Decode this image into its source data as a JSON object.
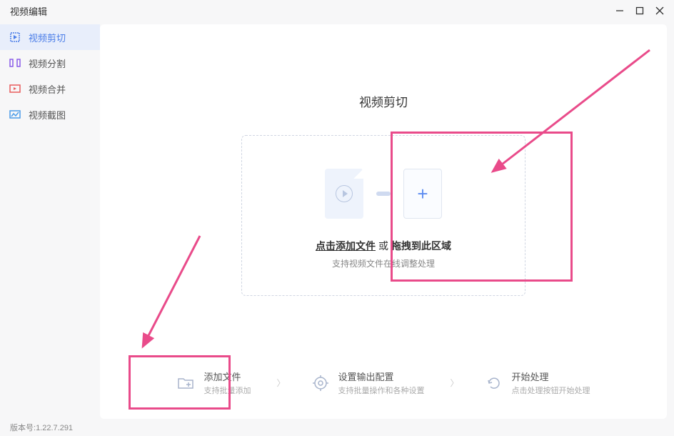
{
  "titlebar": {
    "title": "视频编辑"
  },
  "sidebar": {
    "items": [
      {
        "label": "视频剪切",
        "icon": "crop-icon",
        "active": true
      },
      {
        "label": "视频分割",
        "icon": "split-icon",
        "active": false
      },
      {
        "label": "视频合并",
        "icon": "merge-icon",
        "active": false
      },
      {
        "label": "视频截图",
        "icon": "screenshot-icon",
        "active": false
      }
    ]
  },
  "content": {
    "title": "视频剪切",
    "dropzone": {
      "click_add": "点击添加文件",
      "or": "或",
      "drag_here": "拖拽到此区域",
      "subtext": "支持视频文件在线调整处理"
    }
  },
  "steps": [
    {
      "title": "添加文件",
      "sub": "支持批量添加",
      "icon": "folder-plus-icon"
    },
    {
      "title": "设置输出配置",
      "sub": "支持批量操作和各种设置",
      "icon": "gear-icon"
    },
    {
      "title": "开始处理",
      "sub": "点击处理按钮开始处理",
      "icon": "refresh-icon"
    }
  ],
  "footer": {
    "version_label": "版本号:",
    "version_value": "1.22.7.291"
  }
}
